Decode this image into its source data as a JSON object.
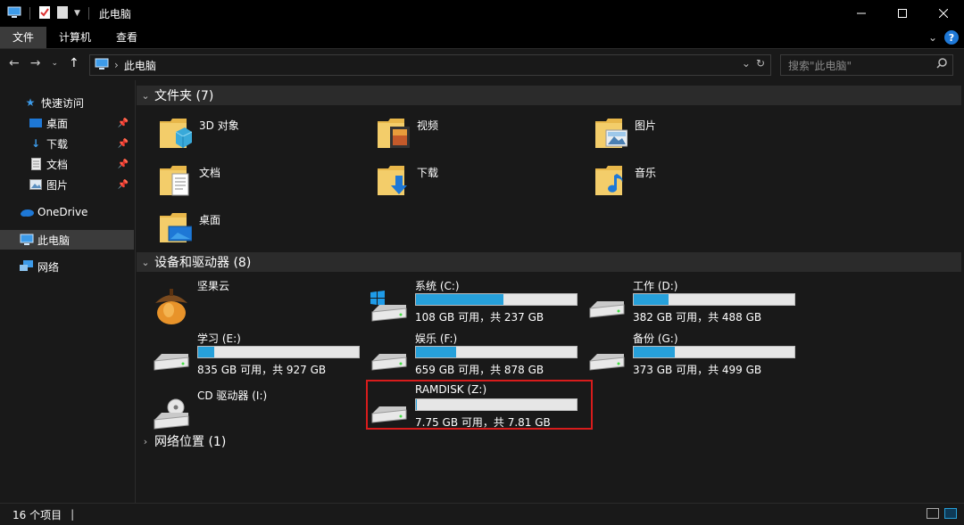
{
  "window": {
    "title": "此电脑",
    "controls": [
      "minimize",
      "maximize",
      "close"
    ]
  },
  "ribbon": {
    "tabs": [
      {
        "label": "文件",
        "active": true
      },
      {
        "label": "计算机",
        "active": false
      },
      {
        "label": "查看",
        "active": false
      }
    ],
    "help": "?"
  },
  "address": {
    "path": "此电脑",
    "search_placeholder": "搜索\"此电脑\""
  },
  "sidebar": {
    "items": [
      {
        "label": "快速访问",
        "icon": "star-icon"
      },
      {
        "label": "桌面",
        "icon": "desktop-icon",
        "pinned": true
      },
      {
        "label": "下载",
        "icon": "download-icon",
        "pinned": true
      },
      {
        "label": "文档",
        "icon": "document-icon",
        "pinned": true
      },
      {
        "label": "图片",
        "icon": "picture-icon",
        "pinned": true
      },
      {
        "label": "OneDrive",
        "icon": "cloud-icon"
      },
      {
        "label": "此电脑",
        "icon": "computer-icon",
        "selected": true
      },
      {
        "label": "网络",
        "icon": "network-icon"
      }
    ]
  },
  "groups": {
    "folders": {
      "label": "文件夹 (7)"
    },
    "devices": {
      "label": "设备和驱动器 (8)"
    },
    "network": {
      "label": "网络位置 (1)"
    }
  },
  "folders": [
    {
      "name": "3D 对象"
    },
    {
      "name": "视频"
    },
    {
      "name": "图片"
    },
    {
      "name": "文档"
    },
    {
      "name": "下载"
    },
    {
      "name": "音乐"
    },
    {
      "name": "桌面"
    }
  ],
  "drives": [
    {
      "name": "坚果云",
      "info": ""
    },
    {
      "name": "系统 (C:)",
      "info": "108 GB 可用，共 237 GB",
      "used_fraction": 0.544
    },
    {
      "name": "工作 (D:)",
      "info": "382 GB 可用，共 488 GB",
      "used_fraction": 0.217
    },
    {
      "name": "学习 (E:)",
      "info": "835 GB 可用，共 927 GB",
      "used_fraction": 0.099
    },
    {
      "name": "娱乐 (F:)",
      "info": "659 GB 可用，共 878 GB",
      "used_fraction": 0.249
    },
    {
      "name": "备份 (G:)",
      "info": "373 GB 可用，共 499 GB",
      "used_fraction": 0.253
    },
    {
      "name": "CD 驱动器 (I:)",
      "info": ""
    },
    {
      "name": "RAMDISK (Z:)",
      "info": "7.75 GB 可用，共 7.81 GB",
      "used_fraction": 0.008
    }
  ],
  "status": {
    "count": "16 个项目"
  },
  "colors": {
    "background": "#191919",
    "bar_fill": "#26a0da",
    "highlight": "#d81c1c"
  }
}
